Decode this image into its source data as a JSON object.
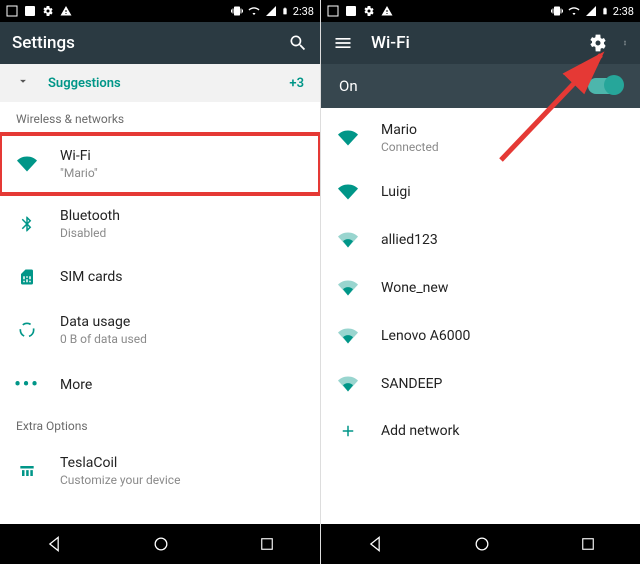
{
  "statusbar": {
    "time": "2:38"
  },
  "left": {
    "title": "Settings",
    "suggestions": {
      "label": "Suggestions",
      "count": "+3"
    },
    "section_wireless": "Wireless & networks",
    "wifi": {
      "label": "Wi-Fi",
      "subtitle": "\"Mario\""
    },
    "bluetooth": {
      "label": "Bluetooth",
      "subtitle": "Disabled"
    },
    "sim": {
      "label": "SIM cards"
    },
    "data": {
      "label": "Data usage",
      "subtitle": "0 B of data used"
    },
    "more": {
      "label": "More"
    },
    "section_extra": "Extra Options",
    "tesla": {
      "label": "TeslaCoil",
      "subtitle": "Customize your device"
    }
  },
  "right": {
    "title": "Wi-Fi",
    "on_label": "On",
    "networks": [
      {
        "name": "Mario",
        "status": "Connected",
        "strength": 4,
        "secure": false
      },
      {
        "name": "Luigi",
        "strength": 4,
        "secure": true
      },
      {
        "name": "allied123",
        "strength": 2,
        "secure": true
      },
      {
        "name": "Wone_new",
        "strength": 2,
        "secure": true
      },
      {
        "name": "Lenovo A6000",
        "strength": 2,
        "secure": true
      },
      {
        "name": "SANDEEP",
        "strength": 2,
        "secure": true
      }
    ],
    "add": "Add network"
  }
}
